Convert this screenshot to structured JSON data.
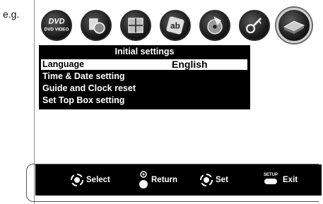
{
  "caption": "e.g.",
  "icons": [
    {
      "name": "dvd-video-icon",
      "label": "DVD VIDEO"
    },
    {
      "name": "picture-icon"
    },
    {
      "name": "display-icon"
    },
    {
      "name": "audio-icon"
    },
    {
      "name": "parental-icon"
    },
    {
      "name": "settings-wrench-icon"
    },
    {
      "name": "initial-settings-icon",
      "selected": true
    }
  ],
  "menu": {
    "title": "Initial settings",
    "items": [
      {
        "label": "Language",
        "value": "English",
        "active": true
      },
      {
        "label": "Time & Date setting"
      },
      {
        "label": "Guide and Clock reset"
      },
      {
        "label": "Set Top Box setting"
      }
    ]
  },
  "nav": {
    "select": "Select",
    "return": "Return",
    "set": "Set",
    "exit": "Exit",
    "setup_button": "SETUP"
  }
}
